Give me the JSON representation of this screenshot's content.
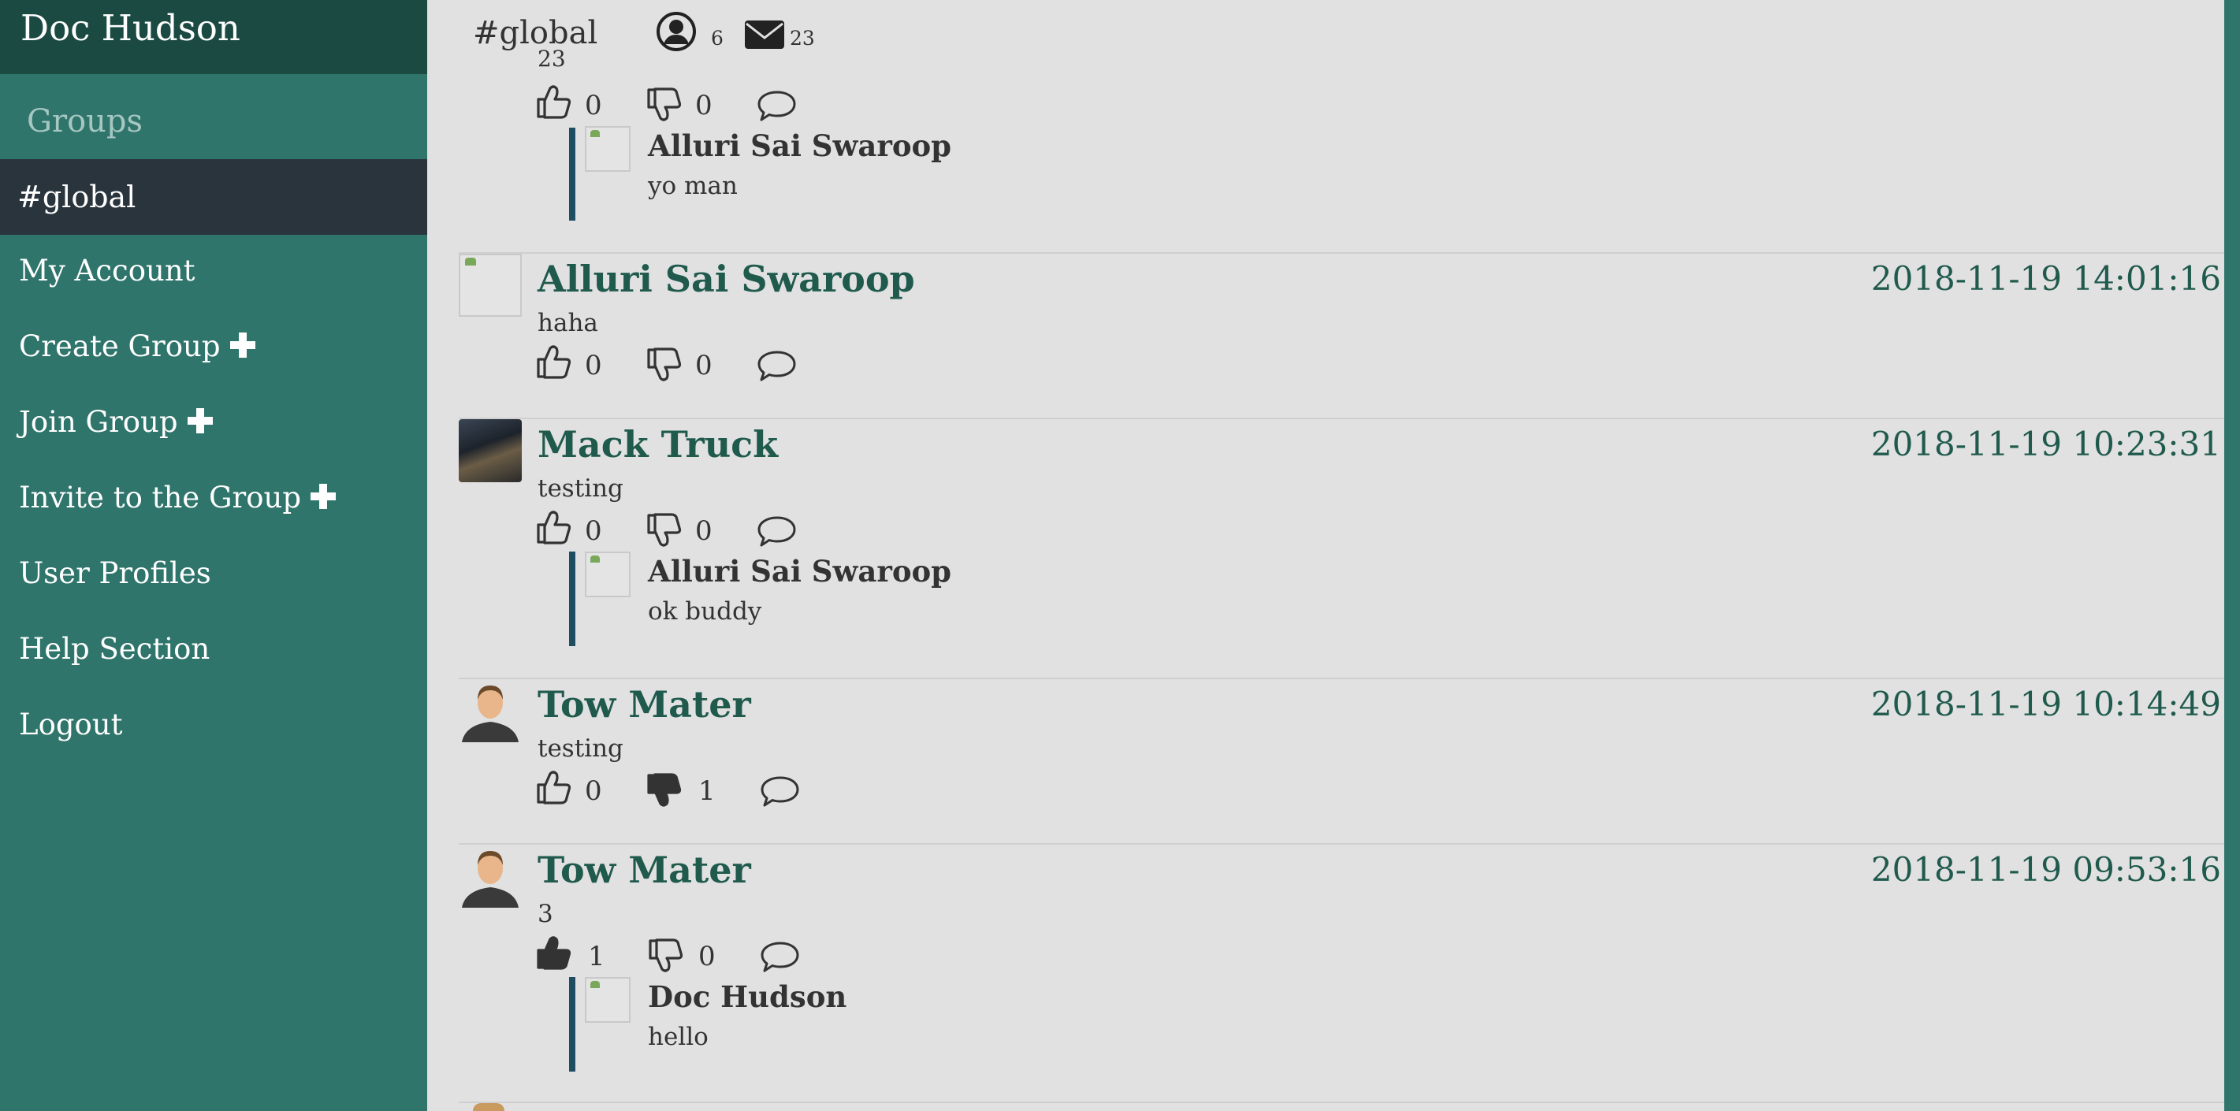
{
  "sidebar": {
    "user_name": "Doc Hudson",
    "groups_label": "Groups",
    "active_group": "#global",
    "items": [
      {
        "label": "My Account"
      },
      {
        "label": "Create Group"
      },
      {
        "label": "Join Group"
      },
      {
        "label": "Invite to the Group"
      },
      {
        "label": "User Profiles"
      },
      {
        "label": "Help Section"
      },
      {
        "label": "Logout"
      }
    ]
  },
  "header": {
    "group_title": "#global",
    "user_count": "6",
    "message_count": "23",
    "partial_text": "23"
  },
  "top_reply": {
    "likes": "0",
    "dislikes": "0",
    "reply_author": "Alluri Sai Swaroop",
    "reply_text": "yo man"
  },
  "posts": [
    {
      "author": "Alluri Sai Swaroop",
      "timestamp": "2018-11-19 14:01:16",
      "text": "haha",
      "likes": "0",
      "dislikes": "0"
    },
    {
      "author": "Mack Truck",
      "timestamp": "2018-11-19 10:23:31",
      "text": "testing",
      "likes": "0",
      "dislikes": "0",
      "reply_author": "Alluri Sai Swaroop",
      "reply_text": "ok buddy"
    },
    {
      "author": "Tow Mater",
      "timestamp": "2018-11-19 10:14:49",
      "text": "testing",
      "likes": "0",
      "dislikes": "1"
    },
    {
      "author": "Tow Mater",
      "timestamp": "2018-11-19 09:53:16",
      "text": "3",
      "likes": "1",
      "dislikes": "0",
      "reply_author": "Doc Hudson",
      "reply_text": "hello"
    }
  ],
  "colors": {
    "sidebar": "#2f756b",
    "sidebar_header": "#1a4a41",
    "active_item": "#2a343d",
    "author_name": "#1f5a4d",
    "reply_bar": "#1f4e63",
    "background": "#e1e1e1"
  }
}
